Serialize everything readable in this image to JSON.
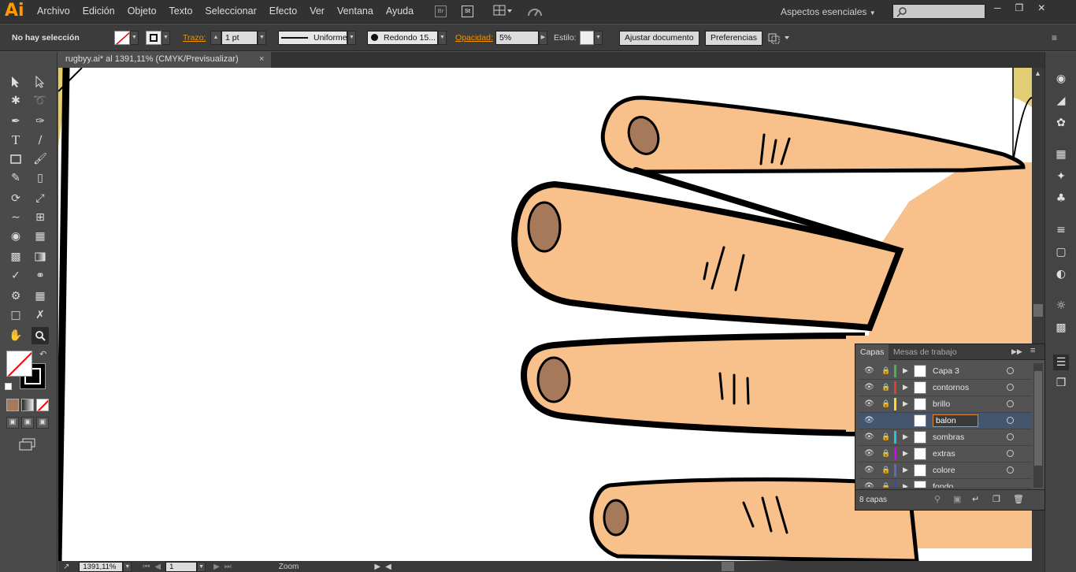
{
  "app": {
    "logo": "Ai"
  },
  "menu": [
    "Archivo",
    "Edición",
    "Objeto",
    "Texto",
    "Seleccionar",
    "Efecto",
    "Ver",
    "Ventana",
    "Ayuda"
  ],
  "menubar_icons": {
    "br": "Br",
    "st": "St"
  },
  "workspace": {
    "label": "Aspectos esenciales"
  },
  "control": {
    "selection": "No hay selección",
    "stroke_label": "Trazo:",
    "stroke_value": "1 pt",
    "profile": "Uniforme",
    "brush": "Redondo 15...",
    "opacity_label": "Opacidad:",
    "opacity_value": "5%",
    "style_label": "Estilo:",
    "doc_button": "Ajustar documento",
    "prefs_button": "Preferencias"
  },
  "document": {
    "tab": "rugbyy.ai* al 1391,11% (CMYK/Previsualizar)",
    "close": "×"
  },
  "layers": {
    "tabs": [
      "Capas",
      "Mesas de trabajo"
    ],
    "rows": [
      {
        "name": "Capa 3",
        "color": "#4caf50"
      },
      {
        "name": "contornos",
        "color": "#e53935"
      },
      {
        "name": "brillo",
        "color": "#fdd835"
      },
      {
        "name": "balon",
        "color": "#44556e"
      },
      {
        "name": "sombras",
        "color": "#26c6da"
      },
      {
        "name": "extras",
        "color": "#d500f9"
      },
      {
        "name": "colore",
        "color": "#5c6bc0"
      },
      {
        "name": "fondo",
        "color": "#3949ab"
      }
    ],
    "count": "8 capas"
  },
  "status": {
    "zoom": "1391,11%",
    "artboard": "1",
    "tool": "Zoom"
  },
  "colors": {
    "skin": "#f8c08a",
    "nail": "#a6795a",
    "outline": "#000000",
    "accent": "#f29400"
  }
}
